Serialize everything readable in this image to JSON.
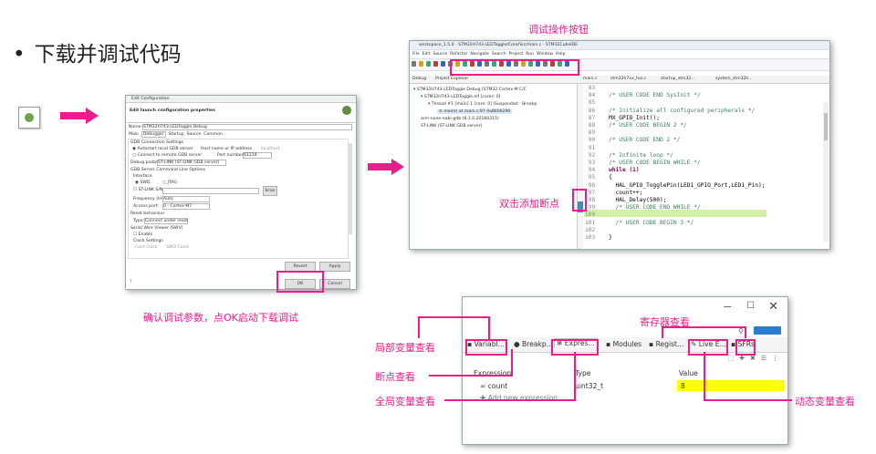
{
  "slide": {
    "bullet": "•",
    "title": "下载并调试代码",
    "caption_confirm": "确认调试参数，点OK启动下载调试",
    "label_toolbar": "调试操作按钮",
    "label_breakpoint": "双击添加断点",
    "label_local": "局部变量查看",
    "label_breakview": "断点查看",
    "label_global": "全局变量查看",
    "label_register": "寄存器查看",
    "label_live": "动态变量查看"
  },
  "config_dialog": {
    "window_title": "Edit Configuration",
    "header": "Edit launch configuration properties",
    "name_label": "Name:",
    "name_value": "STM32H743-LEDToggle Debug",
    "tabs": [
      "Main",
      "Debugger",
      "Startup",
      "Source",
      "Common"
    ],
    "group_gdb": "GDB Connection Settings",
    "opt_autostart": "Autostart local GDB server",
    "host_label": "Host name or IP address",
    "host_value": "localhost",
    "opt_remote": "Connect to remote GDB server",
    "port_label": "Port number",
    "port_value": "61234",
    "probe_label": "Debug probe",
    "probe_value": "ST-LINK (ST-LINK GDB server)",
    "group_cmd": "GDB Server Command Line Options",
    "interface_label": "Interface",
    "swd": "SWD",
    "jtag": "JTAG",
    "stlink_sn": "ST-LINK S/N",
    "scan": "Scan",
    "freq_label": "Frequency (kHz):",
    "freq_value": "Auto",
    "ap_label": "Access port:",
    "ap_value": "0 - Cortex-M7",
    "reset_group": "Reset behaviour",
    "type_label": "Type:",
    "type_value": "Connect under reset",
    "swv_group": "Serial Wire Viewer (SWV)",
    "enable": "Enable",
    "clock_group": "Clock Settings",
    "core_clock": "Core Clock",
    "swo_clock": "SWO Clock",
    "revert": "Revert",
    "apply": "Apply",
    "ok": "OK",
    "cancel": "Cancel"
  },
  "ide": {
    "title": "workspace_1.5.0 - STM32H743-LEDToggle/Core/Src/main.c - STM32CubeIDE",
    "menu": [
      "File",
      "Edit",
      "Source",
      "Refactor",
      "Navigate",
      "Search",
      "Project",
      "Run",
      "Window",
      "Help"
    ],
    "left_tabs": [
      "Debug",
      "Project Explorer"
    ],
    "editor_tabs": [
      "main.c",
      "stm32h7xx_hal.c",
      "startup_stm32...",
      "system_stm32h..."
    ],
    "tree": [
      "STM32H743-LEDToggle Debug [STM32 Cortex-M C/C",
      "STM32H743-LEDToggle.elf [cores: 0]",
      "Thread #1 [main] 1 [core: 0] (Suspended : Breakp",
      "main() at main.c:97 0x8000290",
      "arm-none-eabi-gdb (8.1.0.20180315)",
      "ST-LINK (ST-LINK GDB server)"
    ],
    "code": [
      {
        "n": "83",
        "t": ""
      },
      {
        "n": "84",
        "t": "  /* USER CODE END SysInit */"
      },
      {
        "n": "85",
        "t": ""
      },
      {
        "n": "86",
        "t": "  /* Initialize all configured peripherals */"
      },
      {
        "n": "87",
        "t": "  MX_GPIO_Init();"
      },
      {
        "n": "88",
        "t": "  /* USER CODE BEGIN 2 */"
      },
      {
        "n": "89",
        "t": ""
      },
      {
        "n": "90",
        "t": "  /* USER CODE END 2 */"
      },
      {
        "n": "91",
        "t": ""
      },
      {
        "n": "92",
        "t": "  /* Infinite loop */"
      },
      {
        "n": "93",
        "t": "  /* USER CODE BEGIN WHILE */"
      },
      {
        "n": "94",
        "t": "  while (1)"
      },
      {
        "n": "95",
        "t": "  {"
      },
      {
        "n": "96",
        "t": "    HAL_GPIO_TogglePin(LED1_GPIO_Port,LED1_Pin);"
      },
      {
        "n": "97",
        "t": "    count++;"
      },
      {
        "n": "98",
        "t": "    HAL_Delay(500);"
      },
      {
        "n": "99",
        "t": "    /* USER CODE END WHILE */"
      },
      {
        "n": "100",
        "t": ""
      },
      {
        "n": "101",
        "t": "    /* USER CODE BEGIN 3 */"
      },
      {
        "n": "102",
        "t": ""
      },
      {
        "n": "103",
        "t": "  }"
      }
    ]
  },
  "vars_panel": {
    "tabs": [
      "Variabl...",
      "Breakp...",
      "Expres...",
      "Modules",
      "Regist...",
      "Live E...",
      "SFRs"
    ],
    "col_expression": "Expression",
    "col_type": "Type",
    "col_value": "Value",
    "row_name": "count",
    "row_type": "uint32_t",
    "row_value": "8",
    "add_new": "Add new expression",
    "colors": {
      "value_highlight": "#ffff00",
      "accent": "#e91e8c"
    }
  }
}
